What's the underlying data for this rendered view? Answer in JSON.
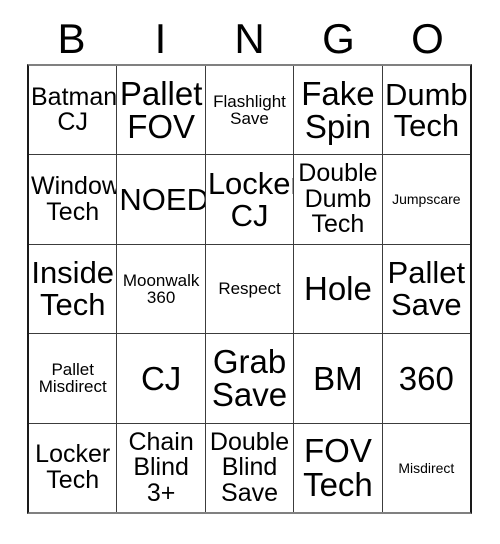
{
  "card": {
    "title": "BINGO",
    "header_letters": [
      "B",
      "I",
      "N",
      "G",
      "O"
    ],
    "columns": 5,
    "rows": 5,
    "colors": {
      "background": "#ffffff",
      "text": "#000000",
      "grid_line": "#3c3c3c",
      "outer_border": "#1a1a1a"
    },
    "cells": [
      [
        {
          "text": "Batman\nCJ",
          "size": "md",
          "marked": false
        },
        {
          "text": "Pallet\nFOV",
          "size": "xxl",
          "marked": false
        },
        {
          "text": "Flashlight\nSave",
          "size": "sm",
          "marked": false
        },
        {
          "text": "Fake\nSpin",
          "size": "xxl",
          "marked": false
        },
        {
          "text": "Dumb\nTech",
          "size": "xl",
          "marked": false
        }
      ],
      [
        {
          "text": "Window\nTech",
          "size": "md",
          "marked": false
        },
        {
          "text": "NOED",
          "size": "xl",
          "marked": false
        },
        {
          "text": "Locker\nCJ",
          "size": "xl",
          "marked": false
        },
        {
          "text": "Double\nDumb\nTech",
          "size": "md",
          "marked": false
        },
        {
          "text": "Jumpscare",
          "size": "xs",
          "marked": false
        }
      ],
      [
        {
          "text": "Inside\nTech",
          "size": "xl",
          "marked": false
        },
        {
          "text": "Moonwalk\n360",
          "size": "sm",
          "marked": false
        },
        {
          "text": "Respect",
          "size": "sm",
          "marked": false
        },
        {
          "text": "Hole",
          "size": "xxl",
          "marked": false
        },
        {
          "text": "Pallet\nSave",
          "size": "xl",
          "marked": false
        }
      ],
      [
        {
          "text": "Pallet\nMisdirect",
          "size": "sm",
          "marked": false
        },
        {
          "text": "CJ",
          "size": "xxl",
          "marked": false
        },
        {
          "text": "Grab\nSave",
          "size": "xxl",
          "marked": false
        },
        {
          "text": "BM",
          "size": "xxl",
          "marked": false
        },
        {
          "text": "360",
          "size": "xxl",
          "marked": false
        }
      ],
      [
        {
          "text": "Locker\nTech",
          "size": "md",
          "marked": false
        },
        {
          "text": "Chain\nBlind\n3+",
          "size": "md",
          "marked": false
        },
        {
          "text": "Double\nBlind\nSave",
          "size": "md",
          "marked": false
        },
        {
          "text": "FOV\nTech",
          "size": "xxl",
          "marked": false
        },
        {
          "text": "Misdirect",
          "size": "xs",
          "marked": false
        }
      ]
    ]
  }
}
